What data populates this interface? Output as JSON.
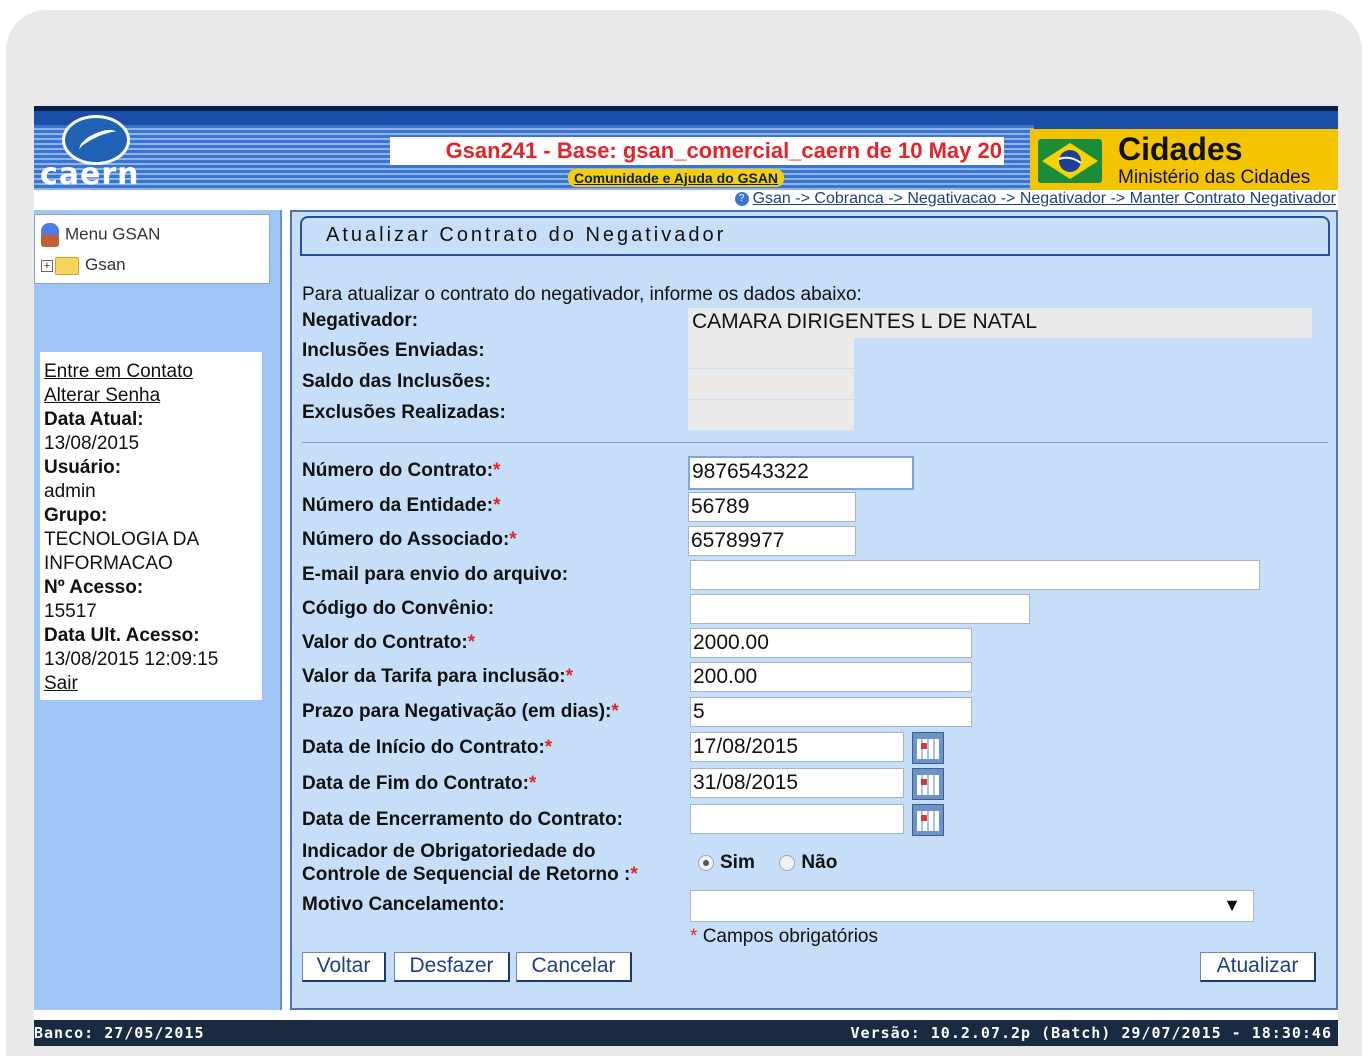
{
  "header": {
    "logo": "caern",
    "title": "Gsan241 - Base: gsan_comercial_caern de 10 May 20",
    "help_link": "Comunidade e Ajuda do GSAN",
    "brand_title": "Cidades",
    "brand_subtitle": "Ministério das Cidades"
  },
  "breadcrumb": "Gsan -> Cobranca -> Negativacao -> Negativador -> Manter Contrato Negativador",
  "sidebar": {
    "menu_label": "Menu GSAN",
    "tree_root": "Gsan",
    "links": {
      "contact": "Entre em Contato",
      "change_password": "Alterar Senha",
      "logout": "Sair"
    },
    "info": [
      {
        "label": "Data Atual:",
        "value": "13/08/2015"
      },
      {
        "label": "Usuário:",
        "value": "admin"
      },
      {
        "label": "Grupo:",
        "value": "TECNOLOGIA DA INFORMACAO"
      },
      {
        "label": "Nº Acesso:",
        "value": "15517"
      },
      {
        "label": "Data Ult. Acesso:",
        "value": "13/08/2015 12:09:15"
      }
    ]
  },
  "form": {
    "title": "Atualizar Contrato do Negativador",
    "intro": "Para atualizar o contrato do negativador, informe os dados abaixo:",
    "labels": {
      "negativador": "Negativador:",
      "inclusoes": "Inclusões Enviadas:",
      "saldo": "Saldo das Inclusões:",
      "exclusoes": "Exclusões Realizadas:",
      "num_contrato": "Número do Contrato:",
      "num_entidade": "Número da Entidade:",
      "num_associado": "Número do Associado:",
      "email": "E-mail para envio do arquivo:",
      "convenio": "Código do Convênio:",
      "valor_contrato": "Valor do Contrato:",
      "valor_tarifa": "Valor da Tarifa para inclusão:",
      "prazo": "Prazo para Negativação (em dias):",
      "data_inicio": "Data de Início do Contrato:",
      "data_fim": "Data de Fim do Contrato:",
      "data_encerramento": "Data de Encerramento do Contrato:",
      "indicador_1": "Indicador de Obrigatoriedade do",
      "indicador_2": "Controle de Sequencial de Retorno :",
      "motivo": "Motivo Cancelamento:"
    },
    "required_mark": "*",
    "values": {
      "negativador": "CAMARA DIRIGENTES L DE NATAL",
      "inclusoes": "",
      "saldo": "",
      "exclusoes": "",
      "num_contrato": "9876543322",
      "num_entidade": "56789",
      "num_associado": "65789977",
      "email": "",
      "convenio": "",
      "valor_contrato": "2000.00",
      "valor_tarifa": "200.00",
      "prazo": "5",
      "data_inicio": "17/08/2015",
      "data_fim": "31/08/2015",
      "data_encerramento": "",
      "motivo": ""
    },
    "radio": {
      "sim": "Sim",
      "nao": "Não",
      "selected": "sim"
    },
    "required_note": "Campos obrigatórios",
    "buttons": {
      "voltar": "Voltar",
      "desfazer": "Desfazer",
      "cancelar": "Cancelar",
      "atualizar": "Atualizar"
    }
  },
  "footer": {
    "left": "Banco: 27/05/2015",
    "right": "Versão: 10.2.07.2p (Batch) 29/07/2015 - 18:30:46"
  }
}
